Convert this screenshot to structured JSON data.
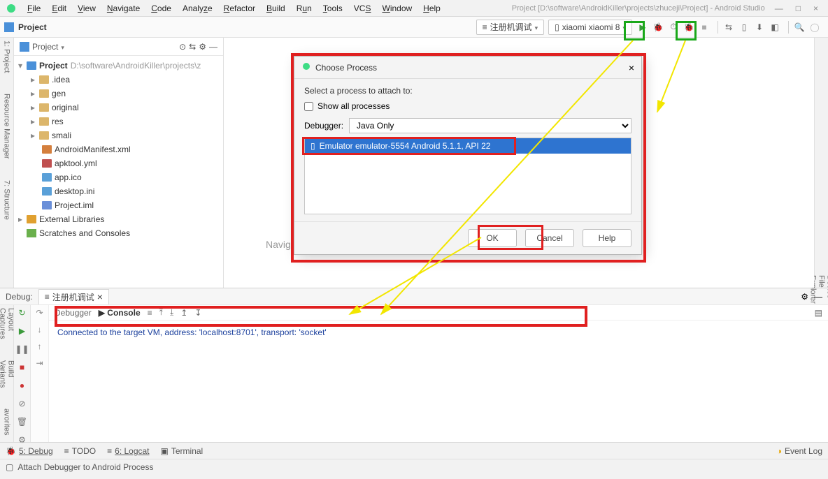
{
  "window": {
    "title": "Project [D:\\software\\AndroidKiller\\projects\\zhuceji\\Project] - Android Studio"
  },
  "menus": [
    "File",
    "Edit",
    "View",
    "Navigate",
    "Code",
    "Analyze",
    "Refactor",
    "Build",
    "Run",
    "Tools",
    "VCS",
    "Window",
    "Help"
  ],
  "toolbar": {
    "project_label": "Project",
    "run_config": "注册机调试",
    "device": "xiaomi xiaomi 8"
  },
  "sidebar_tabs": {
    "project": "1: Project",
    "structure": "7: Structure",
    "resmgr": "Resource Manager",
    "captures": "Layout Captures",
    "variants": "Build Variants",
    "favorites": "avorites",
    "device_explorer": "Device File Explorer"
  },
  "project_panel": {
    "header": "Project",
    "root": {
      "name": "Project",
      "path": "D:\\software\\AndroidKiller\\projects\\z"
    },
    "folders": [
      ".idea",
      "gen",
      "original",
      "res",
      "smali"
    ],
    "files": [
      "AndroidManifest.xml",
      "apktool.yml",
      "app.ico",
      "desktop.ini",
      "Project.iml"
    ],
    "extra": [
      "External Libraries",
      "Scratches and Consoles"
    ]
  },
  "editor": {
    "nav_hint": "Navigation Bar Alt+Home"
  },
  "debug_panel": {
    "label": "Debug:",
    "tab": "注册机调试",
    "subtabs": {
      "debugger": "Debugger",
      "console": "Console"
    },
    "console_text": "Connected to the target VM, address: 'localhost:8701', transport: 'socket'"
  },
  "bottom_tabs": {
    "debug": "5: Debug",
    "todo": "TODO",
    "logcat": "6: Logcat",
    "terminal": "Terminal",
    "eventlog": "Event Log"
  },
  "statusbar": {
    "text": "Attach Debugger to Android Process"
  },
  "dialog": {
    "title": "Choose Process",
    "prompt": "Select a process to attach to:",
    "show_all": "Show all processes",
    "debugger_label": "Debugger:",
    "debugger_value": "Java Only",
    "item": "Emulator emulator-5554 Android 5.1.1, API 22",
    "ok": "OK",
    "cancel": "Cancel",
    "help": "Help"
  }
}
